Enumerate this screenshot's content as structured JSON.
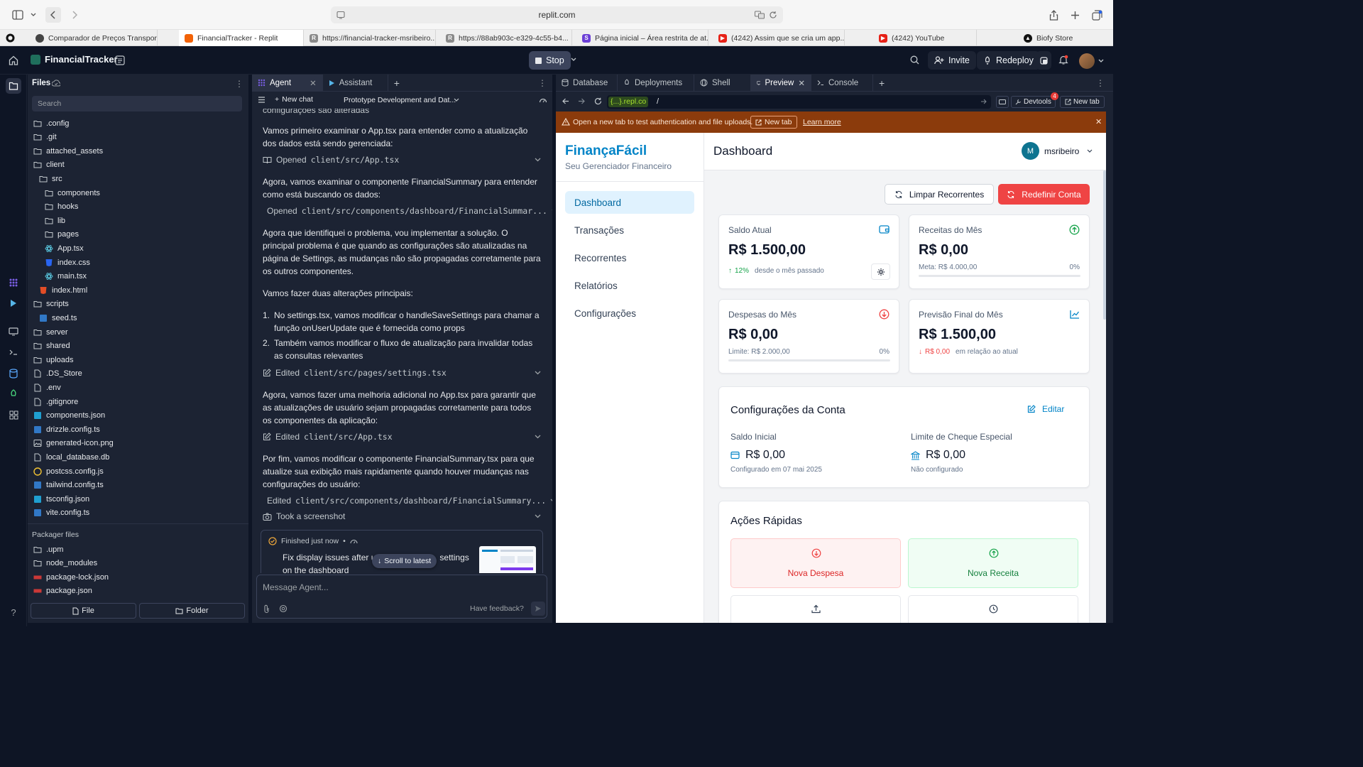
{
  "browser": {
    "url": "replit.com",
    "tabs": [
      {
        "title": "Comparador de Preços Transporte",
        "color": "#444"
      },
      {
        "title": "FinancialTracker - Replit",
        "color": "#f26207",
        "active": true
      },
      {
        "title": "https://financial-tracker-msribeiro...",
        "color": "#8a8a8a"
      },
      {
        "title": "https://88ab903c-e329-4c55-b4...",
        "color": "#8a8a8a"
      },
      {
        "title": "Página inicial – Área restrita de at...",
        "color": "#6b3fd6"
      },
      {
        "title": "(4242) Assim que se cria um app...",
        "color": "#e62117"
      },
      {
        "title": "(4242) YouTube",
        "color": "#e62117"
      },
      {
        "title": "Biofy Store",
        "color": "#111"
      }
    ]
  },
  "replit": {
    "project_name": "FinancialTracker",
    "stop_label": "Stop",
    "invite_label": "Invite",
    "redeploy_label": "Redeploy"
  },
  "files": {
    "title": "Files",
    "search_placeholder": "Search",
    "items": [
      {
        "name": ".config",
        "type": "folder",
        "depth": 0
      },
      {
        "name": ".git",
        "type": "folder",
        "depth": 0
      },
      {
        "name": "attached_assets",
        "type": "folder",
        "depth": 0
      },
      {
        "name": "client",
        "type": "folder",
        "depth": 0
      },
      {
        "name": "src",
        "type": "folder",
        "depth": 1
      },
      {
        "name": "components",
        "type": "folder",
        "depth": 2
      },
      {
        "name": "hooks",
        "type": "folder",
        "depth": 2
      },
      {
        "name": "lib",
        "type": "folder",
        "depth": 2
      },
      {
        "name": "pages",
        "type": "folder",
        "depth": 2
      },
      {
        "name": "App.tsx",
        "type": "react",
        "depth": 2
      },
      {
        "name": "index.css",
        "type": "css",
        "depth": 2
      },
      {
        "name": "main.tsx",
        "type": "react",
        "depth": 2
      },
      {
        "name": "index.html",
        "type": "html",
        "depth": 1
      },
      {
        "name": "scripts",
        "type": "folder",
        "depth": 0
      },
      {
        "name": "seed.ts",
        "type": "ts",
        "depth": 1
      },
      {
        "name": "server",
        "type": "folder",
        "depth": 0
      },
      {
        "name": "shared",
        "type": "folder",
        "depth": 0
      },
      {
        "name": "uploads",
        "type": "folder",
        "depth": 0
      },
      {
        "name": ".DS_Store",
        "type": "file",
        "depth": 0
      },
      {
        "name": ".env",
        "type": "file",
        "depth": 0
      },
      {
        "name": ".gitignore",
        "type": "file",
        "depth": 0
      },
      {
        "name": "components.json",
        "type": "json",
        "depth": 0
      },
      {
        "name": "drizzle.config.ts",
        "type": "ts",
        "depth": 0
      },
      {
        "name": "generated-icon.png",
        "type": "image",
        "depth": 0
      },
      {
        "name": "local_database.db",
        "type": "file",
        "depth": 0
      },
      {
        "name": "postcss.config.js",
        "type": "js",
        "depth": 0
      },
      {
        "name": "tailwind.config.ts",
        "type": "ts",
        "depth": 0
      },
      {
        "name": "tsconfig.json",
        "type": "json",
        "depth": 0
      },
      {
        "name": "vite.config.ts",
        "type": "ts",
        "depth": 0
      }
    ],
    "packager_title": "Packager files",
    "packager_items": [
      {
        "name": ".upm",
        "type": "folder"
      },
      {
        "name": "node_modules",
        "type": "folder"
      },
      {
        "name": "package-lock.json",
        "type": "npm"
      },
      {
        "name": "package.json",
        "type": "npm"
      }
    ],
    "new_file_label": "File",
    "new_folder_label": "Folder"
  },
  "agent": {
    "tab_agent": "Agent",
    "tab_assistant": "Assistant",
    "new_chat_label": "New chat",
    "chat_title": "Prototype Development and Dat...",
    "cut_text": "configurações são alteradas",
    "msg1": "Vamos primeiro examinar o App.tsx para entender como a atualização dos dados está sendo gerenciada:",
    "act1_verb": "Opened",
    "act1_path": "client/src/App.tsx",
    "msg2": "Agora, vamos examinar o componente FinancialSummary para entender como está buscando os dados:",
    "act2_verb": "Opened",
    "act2_path": "client/src/components/dashboard/FinancialSummar...",
    "msg3": "Agora que identifiquei o problema, vou implementar a solução. O principal problema é que quando as configurações são atualizadas na página de Settings, as mudanças não são propagadas corretamente para os outros componentes.",
    "msg4": "Vamos fazer duas alterações principais:",
    "list": [
      "No settings.tsx, vamos modificar o handleSaveSettings para chamar a função onUserUpdate que é fornecida como props",
      "Também vamos modificar o fluxo de atualização para invalidar todas as consultas relevantes"
    ],
    "act3_verb": "Edited",
    "act3_path": "client/src/pages/settings.tsx",
    "msg5": "Agora, vamos fazer uma melhoria adicional no App.tsx para garantir que as atualizações de usuário sejam propagadas corretamente para todos os componentes da aplicação:",
    "act4_verb": "Edited",
    "act4_path": "client/src/App.tsx",
    "msg6": "Por fim, vamos modificar o componente FinancialSummary.tsx para que atualize sua exibição mais rapidamente quando houver mudanças nas configurações do usuário:",
    "act5_verb": "Edited",
    "act5_path": "client/src/components/dashboard/FinancialSummary...",
    "act6": "Took a screenshot",
    "finished_label": "Finished just now",
    "finished_dot": "•",
    "finished_text_a": "Fix display issues after u",
    "finished_text_b": "settings",
    "finished_text_c": "on the dashboard",
    "scroll_latest": "Scroll to latest",
    "input_placeholder": "Message Agent...",
    "feedback": "Have feedback?"
  },
  "tools": {
    "tabs": [
      "Database",
      "Deployments",
      "Shell",
      "Preview",
      "Console"
    ],
    "active_tab": "Preview",
    "address_host": "{...}.repl.co",
    "address_path": "/",
    "devtools": "Devtools",
    "devtools_badge": "4",
    "new_tab": "New tab",
    "banner_text": "Open a new tab to test authentication and file uploads.",
    "banner_newtab": "New tab",
    "banner_learn": "Learn more"
  },
  "app": {
    "brand": "FinançaFácil",
    "tagline": "Seu Gerenciador Financeiro",
    "nav": [
      "Dashboard",
      "Transações",
      "Recorrentes",
      "Relatórios",
      "Configurações"
    ],
    "page_title": "Dashboard",
    "user_initial": "M",
    "user_name": "msribeiro",
    "btn_clear": "Limpar Recorrentes",
    "btn_reset": "Redefinir Conta",
    "saldo": {
      "title": "Saldo Atual",
      "value": "R$ 1.500,00",
      "pct": "12%",
      "note": "desde o mês passado"
    },
    "receitas": {
      "title": "Receitas do Mês",
      "value": "R$ 0,00",
      "meta": "Meta: R$ 4.000,00",
      "pct": "0%",
      "progress": 0
    },
    "despesas": {
      "title": "Despesas do Mês",
      "value": "R$ 0,00",
      "limit": "Limite: R$ 2.000,00",
      "pct": "0%",
      "progress": 0
    },
    "previsao": {
      "title": "Previsão Final do Mês",
      "value": "R$ 1.500,00",
      "delta": "R$ 0,00",
      "note": "em relação ao atual"
    },
    "config": {
      "title": "Configurações da Conta",
      "edit": "Editar",
      "saldo_label": "Saldo Inicial",
      "saldo_value": "R$ 0,00",
      "saldo_note": "Configurado em 07 mai 2025",
      "limite_label": "Limite de Cheque Especial",
      "limite_value": "R$ 0,00",
      "limite_note": "Não configurado"
    },
    "quick": {
      "title": "Ações Rápidas",
      "despesa": "Nova Despesa",
      "receita": "Nova Receita"
    },
    "colors": {
      "brand": "#0284c7",
      "danger": "#ef4444",
      "success": "#16a34a"
    }
  }
}
